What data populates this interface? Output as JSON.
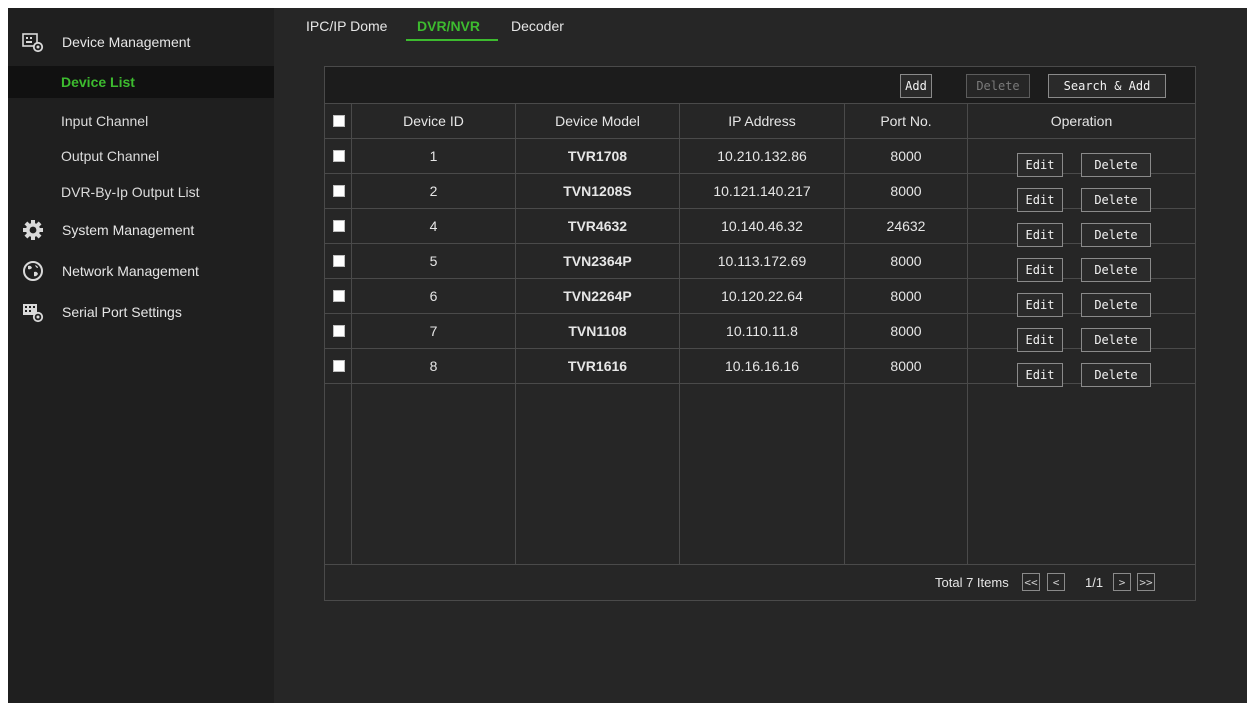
{
  "sidebar": {
    "device_management": {
      "label": "Device Management",
      "icon": "device-settings-icon"
    },
    "items": [
      {
        "label": "Device List",
        "active": true
      },
      {
        "label": "Input Channel"
      },
      {
        "label": "Output Channel"
      },
      {
        "label": "DVR-By-Ip Output List"
      }
    ],
    "system_management": {
      "label": "System Management",
      "icon": "gear-icon"
    },
    "network_management": {
      "label": "Network Management",
      "icon": "globe-icon"
    },
    "serial_port_settings": {
      "label": "Serial Port Settings",
      "icon": "serial-port-settings-icon"
    }
  },
  "tabs": [
    {
      "label": "IPC/IP Dome"
    },
    {
      "label": "DVR/NVR",
      "active": true
    },
    {
      "label": "Decoder"
    }
  ],
  "toolbar": {
    "add_label": "Add",
    "delete_label": "Delete",
    "search_add_label": "Search & Add"
  },
  "table": {
    "columns": [
      "Device ID",
      "Device Model",
      "IP Address",
      "Port No.",
      "Operation"
    ],
    "rows": [
      {
        "id": "1",
        "model": "TVR1708",
        "ip": "10.210.132.86",
        "port": "8000",
        "edit": "Edit",
        "delete": "Delete"
      },
      {
        "id": "2",
        "model": "TVN1208S",
        "ip": "10.121.140.217",
        "port": "8000",
        "edit": "Edit",
        "delete": "Delete"
      },
      {
        "id": "4",
        "model": "TVR4632",
        "ip": "10.140.46.32",
        "port": "24632",
        "edit": "Edit",
        "delete": "Delete"
      },
      {
        "id": "5",
        "model": "TVN2364P",
        "ip": "10.113.172.69",
        "port": "8000",
        "edit": "Edit",
        "delete": "Delete"
      },
      {
        "id": "6",
        "model": "TVN2264P",
        "ip": "10.120.22.64",
        "port": "8000",
        "edit": "Edit",
        "delete": "Delete"
      },
      {
        "id": "7",
        "model": "TVN1108",
        "ip": "10.110.11.8",
        "port": "8000",
        "edit": "Edit",
        "delete": "Delete"
      },
      {
        "id": "8",
        "model": "TVR1616",
        "ip": "10.16.16.16",
        "port": "8000",
        "edit": "Edit",
        "delete": "Delete"
      }
    ]
  },
  "pagination": {
    "total_label": "Total 7 Items",
    "first": "<<",
    "prev": "<",
    "page": "1/1",
    "next": ">",
    "last": ">>"
  },
  "colors": {
    "accent": "#3dbb2f",
    "background": "#262626",
    "sidebar": "#1f1f1f"
  }
}
